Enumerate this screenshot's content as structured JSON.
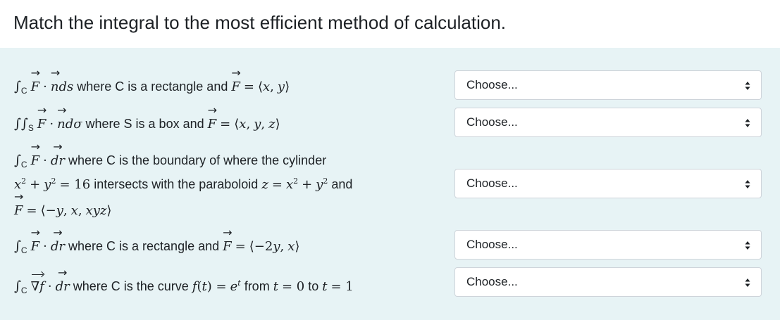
{
  "title": "Match the integral to the most efficient method of calculation.",
  "rows": [
    {
      "text_1": " where C is a rectangle and ",
      "select_value": "Choose..."
    },
    {
      "text_1": " where S is a box and ",
      "select_value": "Choose..."
    },
    {
      "text_1": " where C is the boundary of where the cylinder",
      "text_2": " intersects with the paraboloid ",
      "text_3": " and",
      "select_value": "Choose..."
    },
    {
      "text_1": " where C is a rectangle and ",
      "select_value": "Choose..."
    },
    {
      "text_1": " where C is the curve ",
      "text_2": " from ",
      "text_3": " to ",
      "select_value": "Choose..."
    }
  ],
  "icons": {
    "select_caret": "up-down-caret-icon"
  }
}
